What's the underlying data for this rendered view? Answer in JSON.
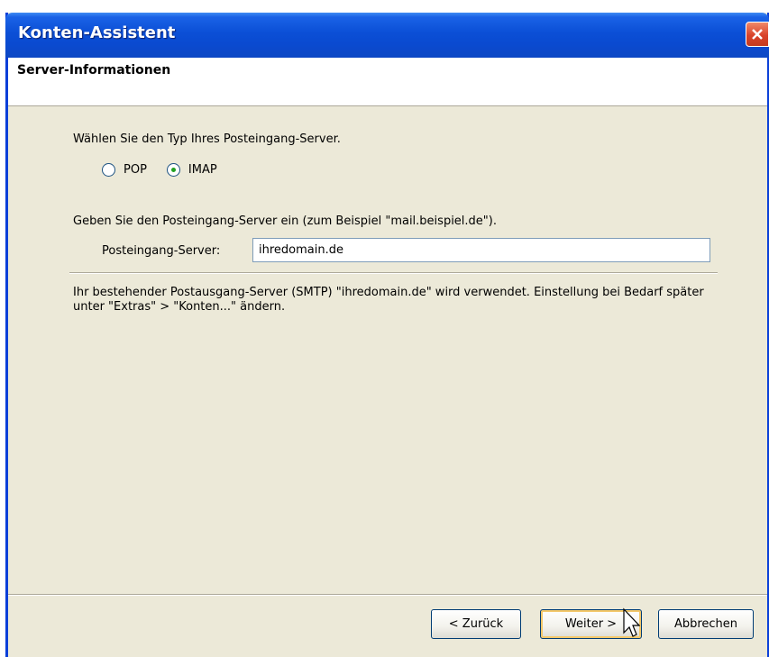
{
  "window": {
    "title": "Konten-Assistent",
    "close_icon": "close-icon"
  },
  "header": {
    "title": "Server-Informationen"
  },
  "form": {
    "prompt_server_type": "Wählen Sie den Typ Ihres Posteingang-Server.",
    "options": [
      {
        "label": "POP",
        "checked": false
      },
      {
        "label": "IMAP",
        "checked": true
      }
    ],
    "prompt_server_name": "Geben Sie den Posteingang-Server ein (zum Beispiel \"mail.beispiel.de\").",
    "field_label": "Posteingang-Server:",
    "field_value": "ihredomain.de",
    "info_text": "Ihr bestehender Postausgang-Server (SMTP) \"ihredomain.de\" wird verwendet. Einstellung bei Bedarf später unter \"Extras\" > \"Konten...\" ändern."
  },
  "buttons": {
    "back": "< Zurück",
    "next": "Weiter >",
    "cancel": "Abbrechen"
  },
  "colors": {
    "titlebar": "#0a4ad0",
    "dialog_bg": "#ece9d8",
    "radio_dot": "#21a121"
  }
}
